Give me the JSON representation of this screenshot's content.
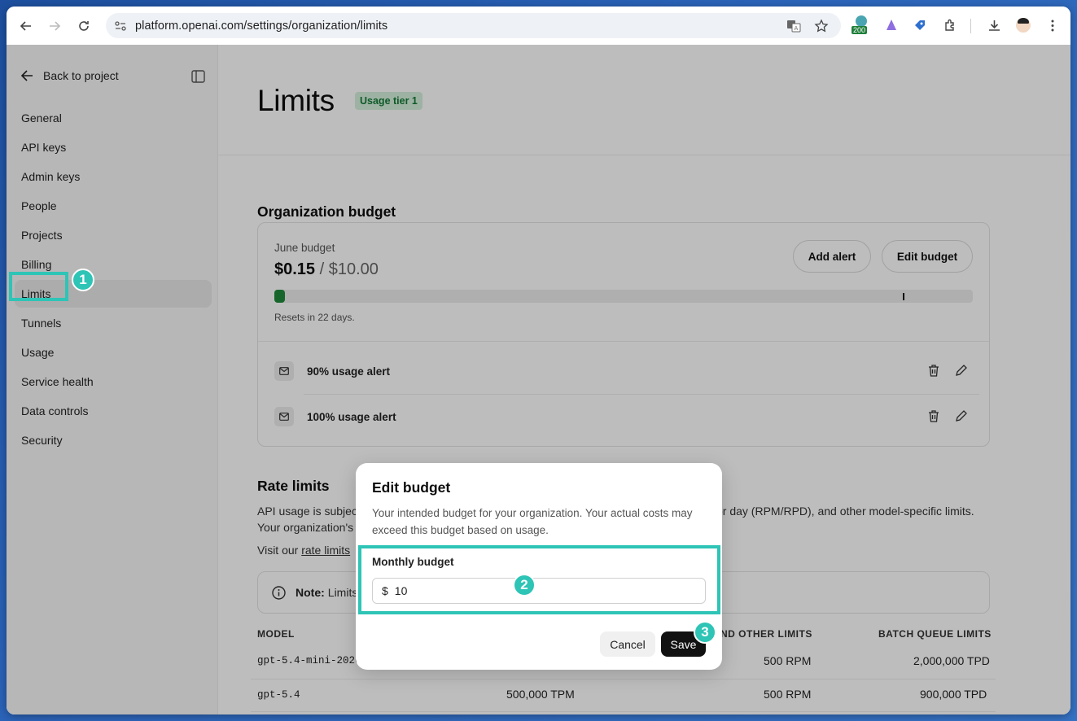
{
  "browser": {
    "url": "platform.openai.com/settings/organization/limits",
    "extension_badge": "200"
  },
  "sidebar": {
    "back_label": "Back to project",
    "items": [
      {
        "label": "General"
      },
      {
        "label": "API keys"
      },
      {
        "label": "Admin keys"
      },
      {
        "label": "People"
      },
      {
        "label": "Projects"
      },
      {
        "label": "Billing"
      },
      {
        "label": "Limits",
        "active": true
      },
      {
        "label": "Tunnels"
      },
      {
        "label": "Usage"
      },
      {
        "label": "Service health"
      },
      {
        "label": "Data controls"
      },
      {
        "label": "Security"
      }
    ]
  },
  "header": {
    "title": "Limits",
    "tier_badge": "Usage tier 1"
  },
  "budget": {
    "section_title": "Organization budget",
    "month_label": "June budget",
    "spent": "$0.15",
    "separator": " / ",
    "limit": "$10.00",
    "progress_fraction": 0.015,
    "marker_fraction": 0.9,
    "reset_text": "Resets in 22 days.",
    "add_alert_label": "Add alert",
    "edit_budget_label": "Edit budget",
    "alerts": [
      {
        "label": "90% usage alert"
      },
      {
        "label": "100% usage alert"
      }
    ]
  },
  "rate_limits": {
    "section_title": "Rate limits",
    "desc_line1_start": "API usage is subject",
    "desc_line1_end": "or day (RPM/RPD), and other model-specific limits.",
    "desc_line2_start": "Your organization's",
    "visit_prefix": "Visit our ",
    "visit_link": "rate limits",
    "note_label": "Note:",
    "note_text": "Limits",
    "table": {
      "headers": {
        "model": "MODEL",
        "other": "ND OTHER LIMITS",
        "batch": "BATCH QUEUE LIMITS"
      },
      "rows": [
        {
          "model": "gpt-5.4-mini-2026-",
          "tpm": "",
          "other": "500 RPM",
          "batch": "2,000,000 TPD"
        },
        {
          "model": "gpt-5.4",
          "tpm": "500,000 TPM",
          "other": "500 RPM",
          "batch": "900,000 TPD"
        }
      ]
    }
  },
  "modal": {
    "title": "Edit budget",
    "description": "Your intended budget for your organization. Your actual costs may exceed this budget based on usage.",
    "field_label": "Monthly budget",
    "currency": "$",
    "value": "10",
    "cancel_label": "Cancel",
    "save_label": "Save"
  },
  "annotations": {
    "colors": {
      "highlight": "#2ec4b6",
      "accent_green": "#1e8a3a"
    },
    "markers": [
      "1",
      "2",
      "3"
    ]
  }
}
